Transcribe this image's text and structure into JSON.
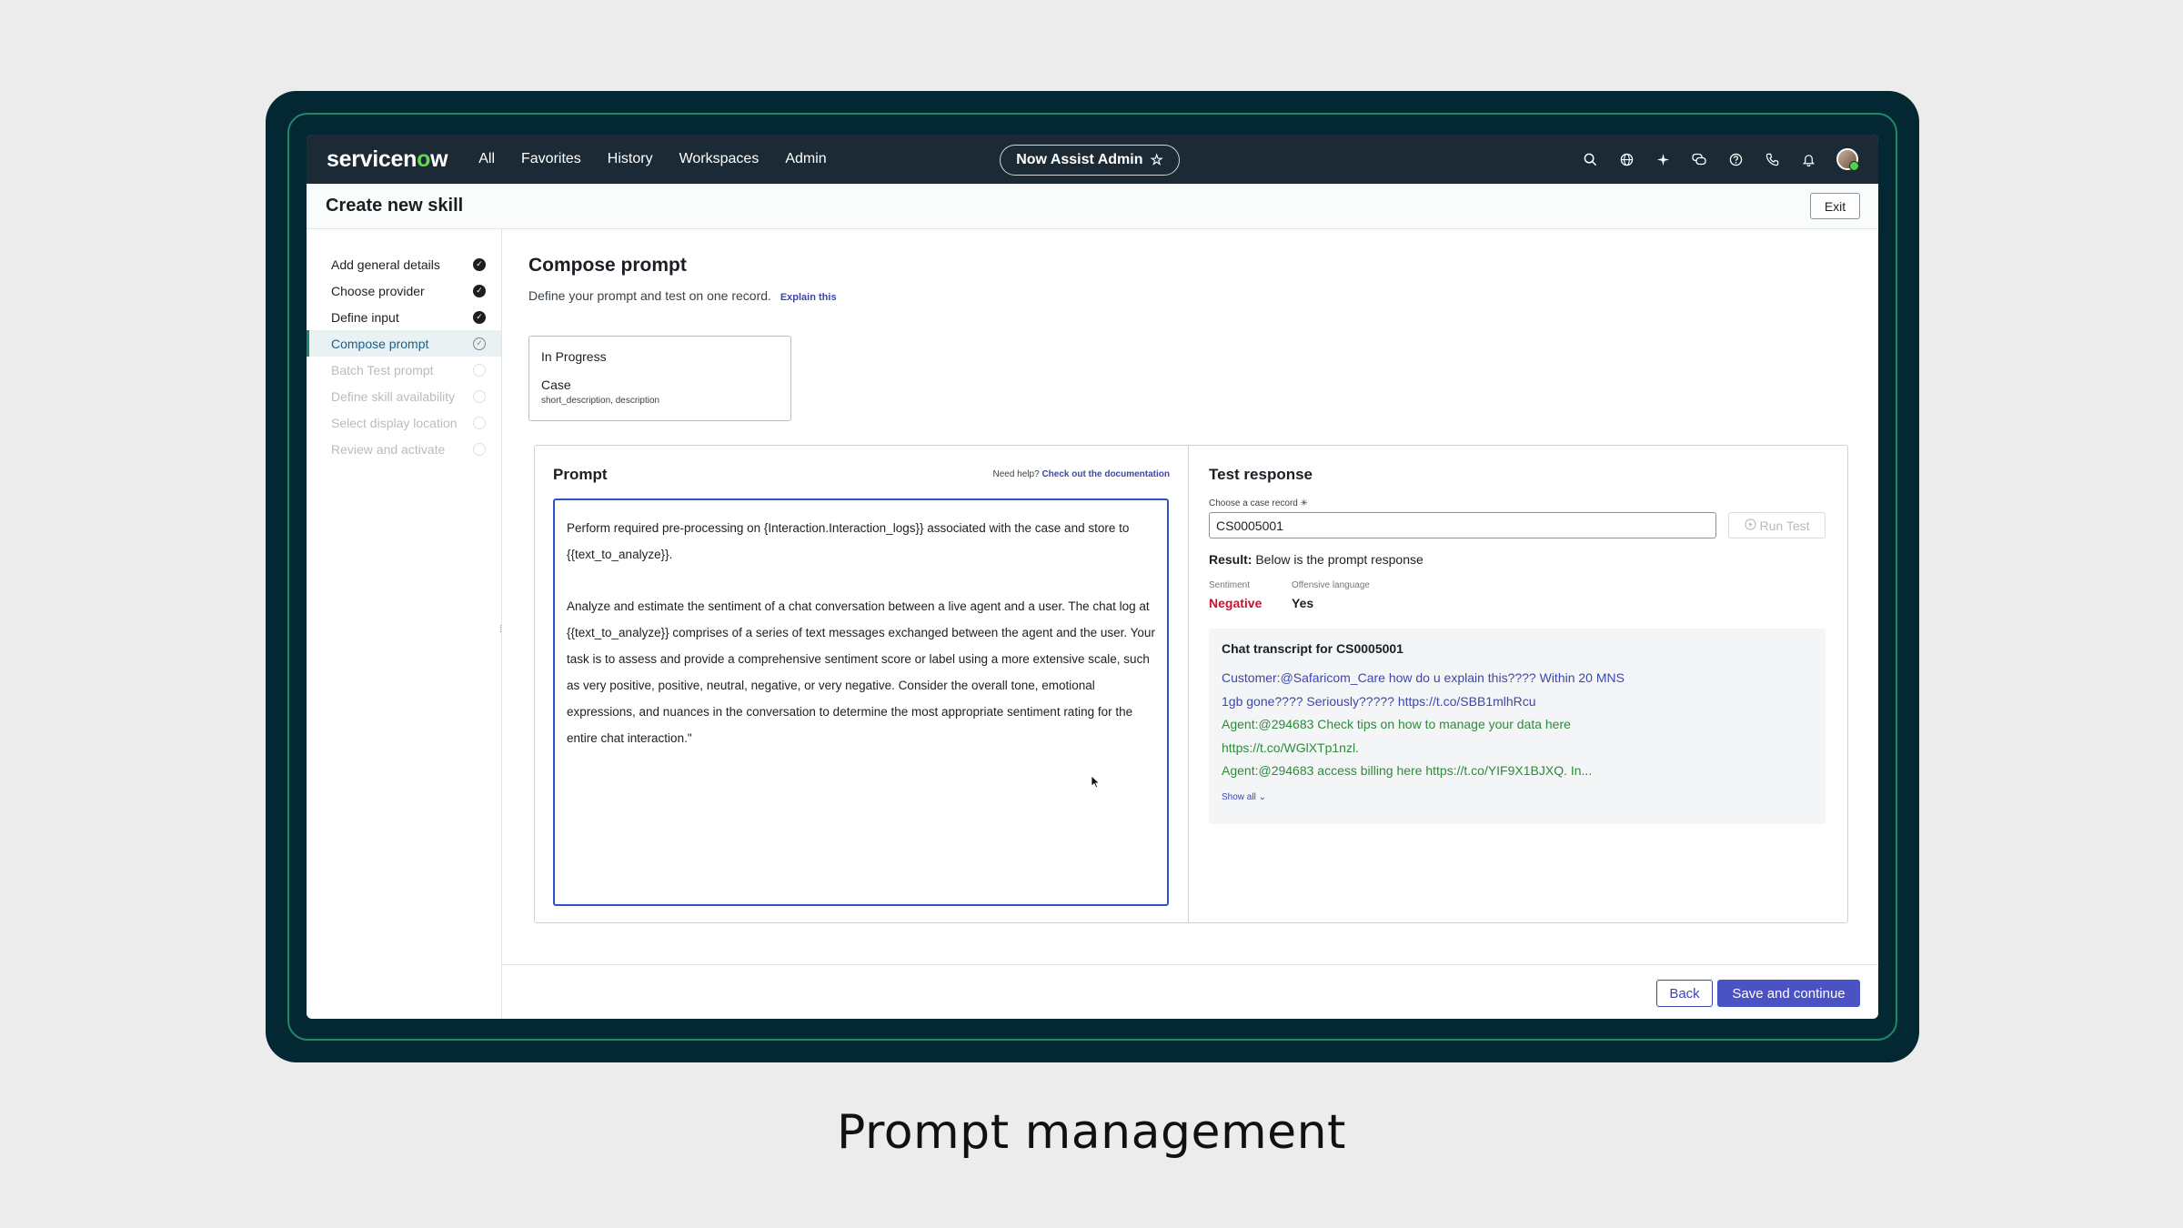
{
  "nav": {
    "logo_prefix": "servicen",
    "logo_o": "o",
    "logo_suffix": "w",
    "items": [
      "All",
      "Favorites",
      "History",
      "Workspaces",
      "Admin"
    ],
    "center_pill": "Now Assist Admin",
    "icons": [
      "search-icon",
      "globe-icon",
      "sparkle-icon",
      "chat-icon",
      "help-icon",
      "phone-icon",
      "bell-icon"
    ]
  },
  "page": {
    "title": "Create new skill",
    "exit_label": "Exit"
  },
  "sidebar": {
    "steps": [
      {
        "label": "Add general details",
        "state": "done"
      },
      {
        "label": "Choose provider",
        "state": "done"
      },
      {
        "label": "Define input",
        "state": "done"
      },
      {
        "label": "Compose prompt",
        "state": "active"
      },
      {
        "label": "Batch Test prompt",
        "state": "todo"
      },
      {
        "label": "Define skill availability",
        "state": "todo"
      },
      {
        "label": "Select display location",
        "state": "todo"
      },
      {
        "label": "Review and activate",
        "state": "todo"
      }
    ]
  },
  "main": {
    "title": "Compose prompt",
    "subtitle": "Define your prompt and test on one record.",
    "explain_link": "Explain this",
    "record": {
      "state": "In Progress",
      "table": "Case",
      "fields": "short_description, description"
    },
    "prompt": {
      "heading": "Prompt",
      "help_text": "Need help?",
      "help_link": "Check out the documentation",
      "paragraph1": "Perform required pre-processing on {Interaction.Interaction_logs}} associated with the case and store to {{text_to_analyze}}.",
      "paragraph2": "Analyze and estimate the sentiment of a chat conversation between a live agent and a user. The chat log at {{text_to_analyze}} comprises of a series of text messages exchanged between the agent and the user. Your task is to assess and provide a comprehensive sentiment score or label using a more extensive scale, such as very positive, positive, neutral, negative, or very negative. Consider the overall tone, emotional expressions, and nuances in the conversation to determine the most appropriate sentiment rating for the entire chat interaction.\""
    },
    "test": {
      "heading": "Test response",
      "record_label": "Choose a case record",
      "required_mark": "✳",
      "record_value": "CS0005001",
      "run_label": "Run Test",
      "result_prefix": "Result:",
      "result_text": "Below is the prompt response",
      "sentiment_label": "Sentiment",
      "sentiment_value": "Negative",
      "offensive_label": "Offensive language",
      "offensive_value": "Yes",
      "transcript_title": "Chat transcript for CS0005001",
      "transcript_lines": [
        {
          "who": "cust",
          "text": "Customer:@Safaricom_Care how do u explain this???? Within 20 MNS"
        },
        {
          "who": "cust",
          "text": "1gb gone???? Seriously????? https://t.co/SBB1mlhRcu"
        },
        {
          "who": "agent",
          "text": "Agent:@294683 Check tips on how to manage your data here"
        },
        {
          "who": "agent",
          "text": "https://t.co/WGlXTp1nzl."
        },
        {
          "who": "agent",
          "text": "Agent:@294683 access billing here https://t.co/YIF9X1BJXQ. In..."
        }
      ],
      "show_all": "Show all"
    }
  },
  "footer": {
    "back_label": "Back",
    "save_label": "Save and continue"
  },
  "caption": "Prompt management",
  "colors": {
    "accent": "#4a52c4",
    "nav_bg": "#1b2a34",
    "frame": "#032733",
    "negative": "#c8102e"
  }
}
